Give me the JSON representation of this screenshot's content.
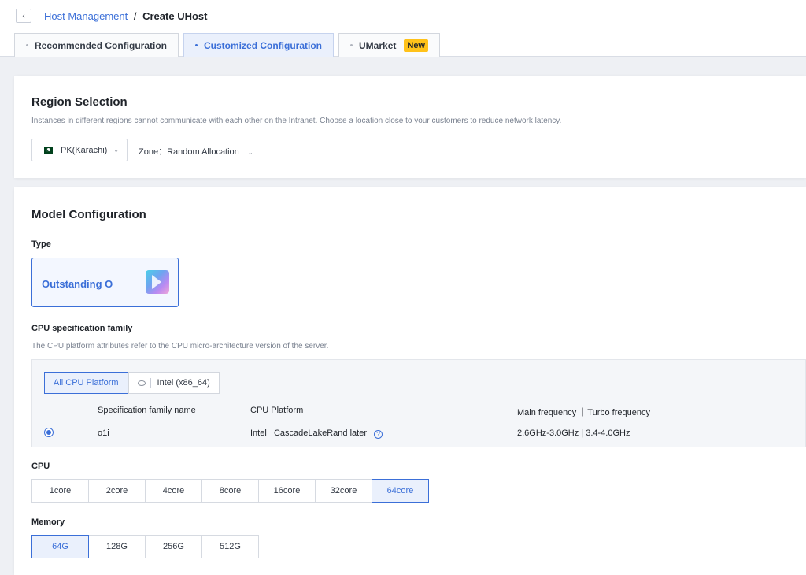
{
  "header": {
    "back_icon": "chevron-left-icon",
    "breadcrumb_link": "Host Management",
    "breadcrumb_sep": "/",
    "breadcrumb_current": "Create UHost"
  },
  "tabs": [
    {
      "label": "Recommended Configuration",
      "active": false
    },
    {
      "label": "Customized Configuration",
      "active": true
    },
    {
      "label": "UMarket",
      "active": false,
      "badge": "New"
    }
  ],
  "region": {
    "title": "Region Selection",
    "description": "Instances in different regions cannot communicate with each other on the Intranet. Choose a location close to your customers to reduce network latency.",
    "selected_region": "PK(Karachi)",
    "zone": "Zone：Random Allocation"
  },
  "model": {
    "title": "Model Configuration",
    "type_label": "Type",
    "type_option": "Outstanding O",
    "cpu_family_label": "CPU specification family",
    "cpu_family_desc": "The CPU platform attributes refer to the CPU micro-architecture version of the server.",
    "platform_tabs": [
      "All CPU Platform",
      "Intel (x86_64)"
    ],
    "table_headers": {
      "name": "Specification family name",
      "platform": "CPU Platform",
      "frequency": "Main frequency  ｜Turbo frequency"
    },
    "table_row": {
      "name": "o1i",
      "platform_vendor": "Intel",
      "platform_arch": "CascadeLakeRand later",
      "frequency": "2.6GHz-3.0GHz | 3.4-4.0GHz"
    },
    "cpu_label": "CPU",
    "cpu_options": [
      "1core",
      "2core",
      "4core",
      "8core",
      "16core",
      "32core",
      "64core"
    ],
    "cpu_selected": "64core",
    "memory_label": "Memory",
    "memory_options": [
      "64G",
      "128G",
      "256G",
      "512G"
    ],
    "memory_selected": "64G"
  },
  "colors": {
    "accent": "#3b6fd8",
    "badge": "#ffc21a",
    "page_bg": "#eef0f4"
  }
}
